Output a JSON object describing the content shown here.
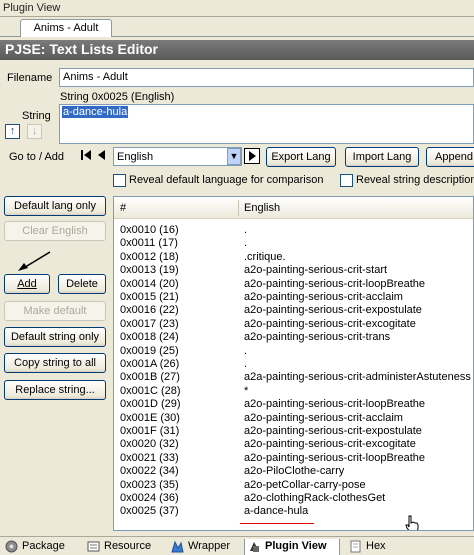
{
  "window": {
    "title": "Plugin View"
  },
  "doc_tab": {
    "label": "Anims - Adult"
  },
  "editor": {
    "title": "PJSE: Text Lists Editor"
  },
  "filename": {
    "label": "Filename",
    "value": "Anims - Adult"
  },
  "string": {
    "header": "String 0x0025 (English)",
    "label": "String",
    "value": "a-dance-hula"
  },
  "goto": {
    "label": "Go to / Add",
    "language": "English"
  },
  "buttons": {
    "export_lang": "Export Lang",
    "import_lang": "Import Lang",
    "append": "Append",
    "default_lang_only": "Default lang only",
    "clear_english": "Clear English",
    "add": "Add",
    "delete": "Delete",
    "make_default": "Make default",
    "default_string_only": "Default string only",
    "copy_string_to_all": "Copy string to all",
    "replace_string": "Replace string..."
  },
  "checkboxes": {
    "reveal_default": "Reveal default language for comparison",
    "reveal_desc": "Reveal string description"
  },
  "list": {
    "col_num": "#",
    "col_lang": "English",
    "rows": [
      {
        "id": "0x0010 (16)",
        "text": "."
      },
      {
        "id": "0x0011 (17)",
        "text": "."
      },
      {
        "id": "0x0012 (18)",
        "text": ".critique."
      },
      {
        "id": "0x0013 (19)",
        "text": "a2o-painting-serious-crit-start"
      },
      {
        "id": "0x0014 (20)",
        "text": "a2o-painting-serious-crit-loopBreathe"
      },
      {
        "id": "0x0015 (21)",
        "text": "a2o-painting-serious-crit-acclaim"
      },
      {
        "id": "0x0016 (22)",
        "text": "a2o-painting-serious-crit-expostulate"
      },
      {
        "id": "0x0017 (23)",
        "text": "a2o-painting-serious-crit-excogitate"
      },
      {
        "id": "0x0018 (24)",
        "text": "a2o-painting-serious-crit-trans"
      },
      {
        "id": "0x0019 (25)",
        "text": "."
      },
      {
        "id": "0x001A (26)",
        "text": "."
      },
      {
        "id": "0x001B (27)",
        "text": "a2a-painting-serious-crit-administerAstuteness"
      },
      {
        "id": "0x001C (28)",
        "text": "*"
      },
      {
        "id": "0x001D (29)",
        "text": "a2o-painting-serious-crit-loopBreathe"
      },
      {
        "id": "0x001E (30)",
        "text": "a2o-painting-serious-crit-acclaim"
      },
      {
        "id": "0x001F (31)",
        "text": "a2o-painting-serious-crit-expostulate"
      },
      {
        "id": "0x0020 (32)",
        "text": "a2o-painting-serious-crit-excogitate"
      },
      {
        "id": "0x0021 (33)",
        "text": "a2o-painting-serious-crit-loopBreathe"
      },
      {
        "id": "0x0022 (34)",
        "text": "a2o-PiloClothe-carry"
      },
      {
        "id": "0x0023 (35)",
        "text": "a2o-petCollar-carry-pose"
      },
      {
        "id": "0x0024 (36)",
        "text": "a2o-clothingRack-clothesGet"
      },
      {
        "id": "0x0025 (37)",
        "text": "a-dance-hula"
      }
    ]
  },
  "bottom_tabs": [
    {
      "label": "Package",
      "icon": "package-icon"
    },
    {
      "label": "Resource",
      "icon": "resource-icon"
    },
    {
      "label": "Wrapper",
      "icon": "wrapper-icon"
    },
    {
      "label": "Plugin View",
      "icon": "plugin-view-icon"
    },
    {
      "label": "Hex",
      "icon": "hex-icon"
    }
  ]
}
